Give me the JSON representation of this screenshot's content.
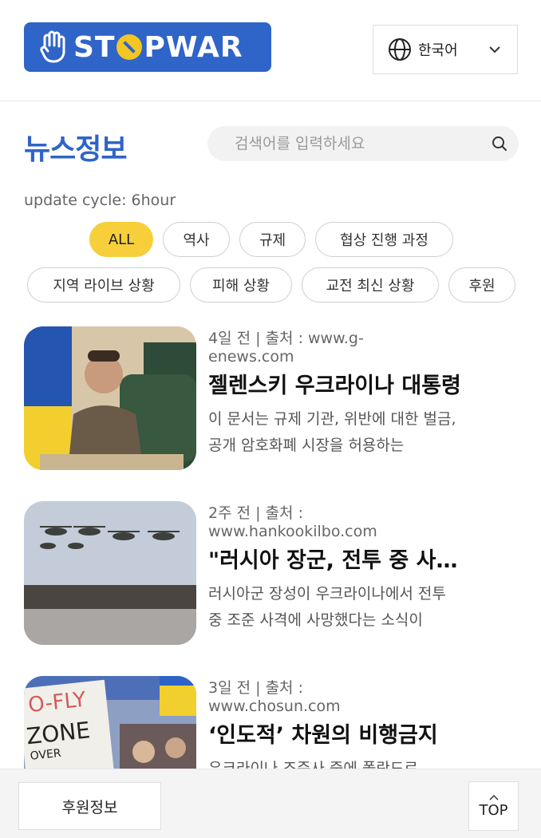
{
  "header": {
    "logo_text_1": "ST",
    "logo_text_2": "PWAR",
    "language": "한국어"
  },
  "page": {
    "title": "뉴스정보",
    "search_placeholder": "검색어를 입력하세요",
    "update_cycle": "update cycle: 6hour"
  },
  "categories": [
    "ALL",
    "역사",
    "규제",
    "협상 진행 과정",
    "지역 라이브 상황",
    "피해 상황",
    "교전 최신 상황",
    "후원"
  ],
  "news": [
    {
      "meta": "4일 전 | 출처 : www.g-enews.com",
      "title": "젤렌스키 우크라이나 대통령",
      "summary": "이 문서는 규제 기관, 위반에 대한 벌금, 공개 암호화폐 시장을 허용하는"
    },
    {
      "meta": "2주 전 | 출처 : www.hankookilbo.com",
      "title": "\"러시아 장군, 전투 중 사망\"",
      "summary": "러시아군 장성이 우크라이나에서 전투 중 조준 사격에 사망했다는 소식이"
    },
    {
      "meta": "3일 전 | 출처 : www.chosun.com",
      "title": "‘인도적’ 차원의 비행금지",
      "summary": "우크라이나 조준사 중에 폴란드로"
    }
  ],
  "footer": {
    "sponsor": "후원정보",
    "top": "TOP"
  },
  "colors": {
    "brand_blue": "#2f64c8",
    "accent_yellow": "#f6cf3a"
  }
}
